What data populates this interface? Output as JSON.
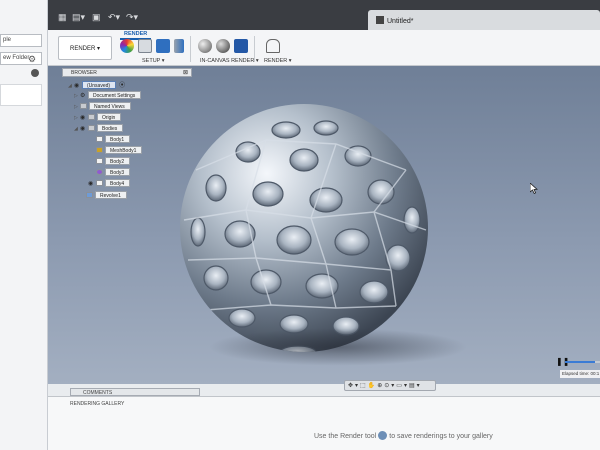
{
  "left_panel": {
    "field_1": "ple",
    "field_2": "ew Folder"
  },
  "titlebar": {
    "doc_title": "Untitled*"
  },
  "ribbon": {
    "workspace": "RENDER ▾",
    "active_tab": "RENDER",
    "groups": {
      "setup": "SETUP ▾",
      "in_canvas": "IN-CANVAS RENDER ▾",
      "render": "RENDER ▾"
    }
  },
  "browser": {
    "title": "BROWSER",
    "items": [
      {
        "label": "(Unsaved)"
      },
      {
        "label": "Document Settings"
      },
      {
        "label": "Named Views"
      },
      {
        "label": "Origin"
      },
      {
        "label": "Bodies"
      },
      {
        "label": "Body1"
      },
      {
        "label": "MeshBody1"
      },
      {
        "label": "Body2"
      },
      {
        "label": "Body3"
      },
      {
        "label": "Body4"
      },
      {
        "label": "Revolve1"
      }
    ]
  },
  "render_status": {
    "elapsed": "Elapsed time: 00:1",
    "progress": 0.85
  },
  "bottom": {
    "comments": "COMMENTS",
    "gallery_title": "RENDERING GALLERY",
    "hint_prefix": "Use the Render tool",
    "hint_suffix": "to save renderings to your gallery"
  },
  "colors": {
    "viewport_top": "#6f7f97",
    "viewport_bottom": "#a3afc1",
    "accent": "#1a5fae",
    "titlebar": "#3a3d42"
  }
}
